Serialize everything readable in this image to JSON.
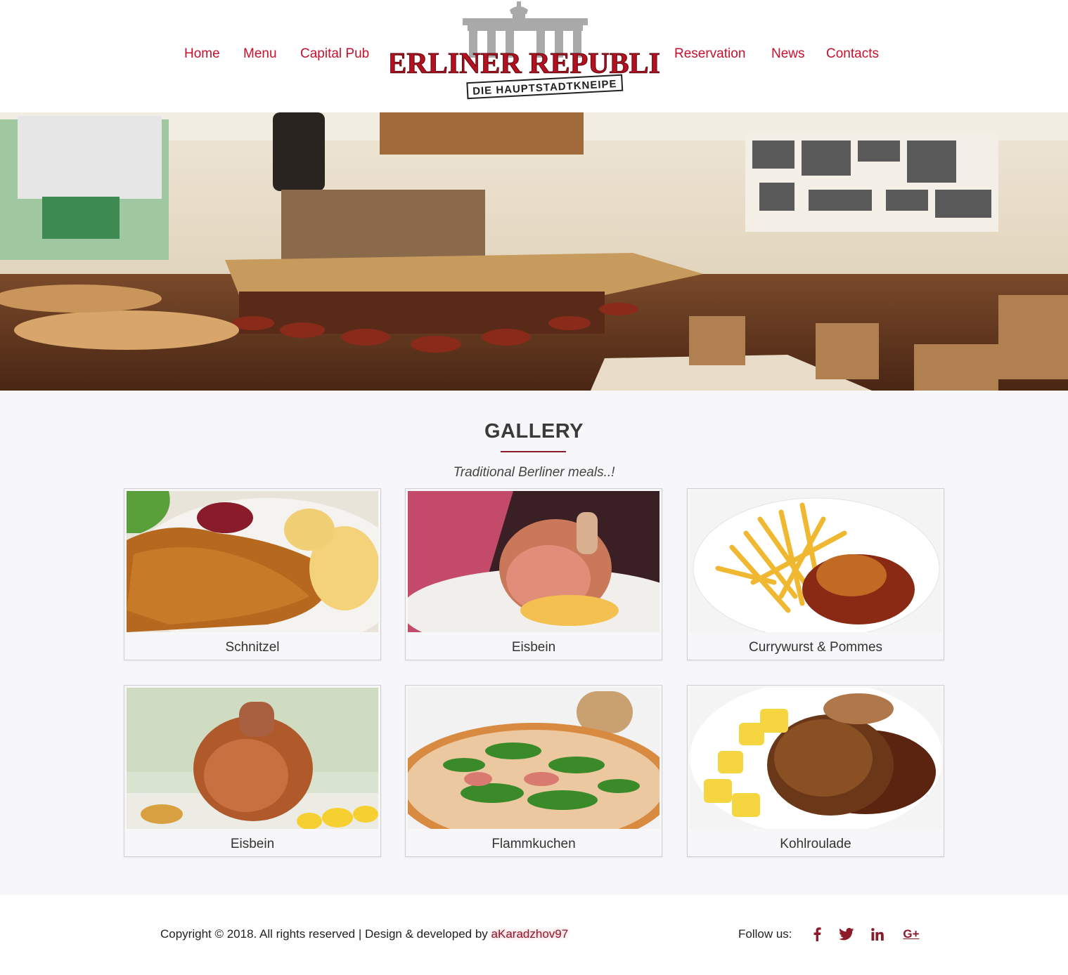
{
  "nav": {
    "left": [
      {
        "label": "Home"
      },
      {
        "label": "Menu"
      },
      {
        "label": "Capital Pub"
      }
    ],
    "right": [
      {
        "label": "Reservation"
      },
      {
        "label": "News"
      },
      {
        "label": "Contacts"
      }
    ]
  },
  "logo": {
    "title": "BERLINER REPUBLIK",
    "tagline": "DIE HAUPTSTADTKNEIPE"
  },
  "gallery": {
    "title": "GALLERY",
    "subtitle": "Traditional Berliner meals..!",
    "items": [
      {
        "caption": "Schnitzel"
      },
      {
        "caption": "Eisbein"
      },
      {
        "caption": "Currywurst & Pommes"
      },
      {
        "caption": "Eisbein"
      },
      {
        "caption": "Flammkuchen"
      },
      {
        "caption": "Kohlroulade"
      }
    ]
  },
  "footer": {
    "copyright": "Copyright © 2018. All rights reserved | Design & developed by",
    "author": "aKaradzhov97",
    "follow_label": "Follow us:",
    "social": [
      {
        "icon": "facebook-icon",
        "glyph": "f"
      },
      {
        "icon": "twitter-icon",
        "glyph": "t"
      },
      {
        "icon": "linkedin-icon",
        "glyph": "in"
      },
      {
        "icon": "google-plus-icon",
        "glyph": "G+"
      }
    ]
  },
  "colors": {
    "accent": "#c8102e",
    "dark_accent": "#8b1a2b",
    "gallery_bg": "#f7f7f9"
  }
}
